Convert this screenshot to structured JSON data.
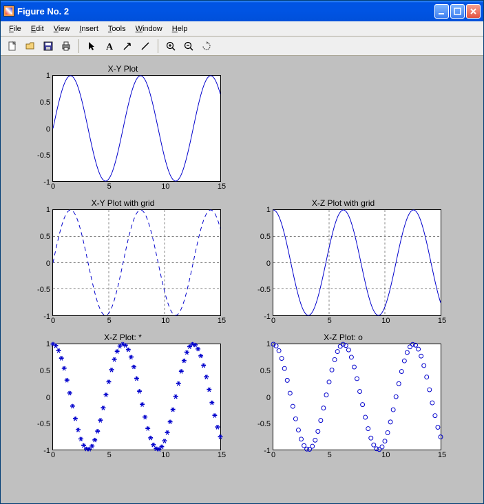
{
  "window": {
    "title": "Figure No. 2"
  },
  "menu": {
    "file": "File",
    "edit": "Edit",
    "view": "View",
    "insert": "Insert",
    "tools": "Tools",
    "window": "Window",
    "help": "Help"
  },
  "chart_data": [
    {
      "id": "xy",
      "title": "X-Y Plot",
      "type": "line",
      "style": "solid",
      "grid": false,
      "xlim": [
        0,
        15
      ],
      "ylim": [
        -1,
        1
      ],
      "xticks": [
        0,
        5,
        10,
        15
      ],
      "yticks": [
        -1,
        -0.5,
        0,
        0.5,
        1
      ],
      "series": [
        {
          "name": "sin(x)",
          "expr": "sin",
          "color": "#0000cc"
        }
      ]
    },
    {
      "id": "xy_grid",
      "title": "X-Y Plot with grid",
      "type": "line",
      "style": "dashed",
      "grid": true,
      "xlim": [
        0,
        15
      ],
      "ylim": [
        -1,
        1
      ],
      "xticks": [
        0,
        5,
        10,
        15
      ],
      "yticks": [
        -1,
        -0.5,
        0,
        0.5,
        1
      ],
      "series": [
        {
          "name": "sin(x)",
          "expr": "sin",
          "color": "#0000cc"
        }
      ]
    },
    {
      "id": "xz_grid",
      "title": "X-Z Plot with grid",
      "type": "line",
      "style": "solid",
      "grid": true,
      "xlim": [
        0,
        15
      ],
      "ylim": [
        -1,
        1
      ],
      "xticks": [
        0,
        5,
        10,
        15
      ],
      "yticks": [
        -1,
        -0.5,
        0,
        0.5,
        1
      ],
      "series": [
        {
          "name": "cos(x)",
          "expr": "cos",
          "color": "#0000cc"
        }
      ]
    },
    {
      "id": "xz_star",
      "title": "X-Z Plot: *",
      "type": "scatter",
      "marker": "star",
      "grid": false,
      "xlim": [
        0,
        15
      ],
      "ylim": [
        -1,
        1
      ],
      "xticks": [
        0,
        5,
        10,
        15
      ],
      "yticks": [
        -1,
        -0.5,
        0,
        0.5,
        1
      ],
      "series": [
        {
          "name": "cos(x)",
          "expr": "cos",
          "color": "#0000cc",
          "dx": 0.25
        }
      ]
    },
    {
      "id": "xz_o",
      "title": "X-Z Plot: o",
      "type": "scatter",
      "marker": "circle",
      "grid": false,
      "xlim": [
        0,
        15
      ],
      "ylim": [
        -1,
        1
      ],
      "xticks": [
        0,
        5,
        10,
        15
      ],
      "yticks": [
        -1,
        -0.5,
        0,
        0.5,
        1
      ],
      "series": [
        {
          "name": "cos(x)",
          "expr": "cos",
          "color": "#0000cc",
          "dx": 0.25
        }
      ]
    }
  ]
}
